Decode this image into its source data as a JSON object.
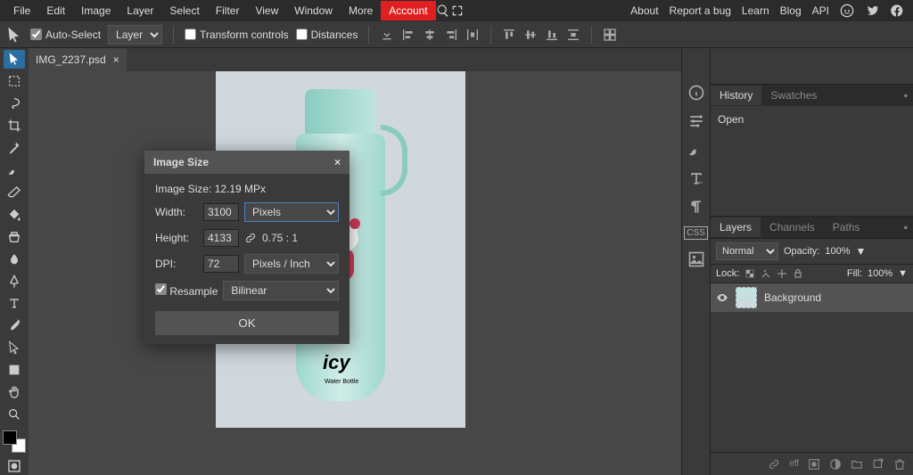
{
  "menu": {
    "file": "File",
    "edit": "Edit",
    "image": "Image",
    "layer": "Layer",
    "select": "Select",
    "filter": "Filter",
    "view": "View",
    "window": "Window",
    "more": "More",
    "account": "Account"
  },
  "rightmenu": {
    "about": "About",
    "bug": "Report a bug",
    "learn": "Learn",
    "blog": "Blog",
    "api": "API"
  },
  "optbar": {
    "autoselect": "Auto-Select",
    "layer_select": "Layer",
    "transform": "Transform controls",
    "distances": "Distances"
  },
  "doc": {
    "name": "IMG_2237.psd"
  },
  "dialog": {
    "title": "Image Size",
    "size_line": "Image Size: 12.19 MPx",
    "width_lbl": "Width:",
    "width_val": "3100",
    "height_lbl": "Height:",
    "height_val": "4133",
    "dpi_lbl": "DPI:",
    "dpi_val": "72",
    "unit": "Pixels",
    "dpi_unit": "Pixels / Inch",
    "ratio": "0.75 : 1",
    "resample_lbl": "Resample",
    "resample_method": "Bilinear",
    "ok": "OK"
  },
  "panels": {
    "history_tab": "History",
    "swatches_tab": "Swatches",
    "hist_open": "Open",
    "layers_tab": "Layers",
    "channels_tab": "Channels",
    "paths_tab": "Paths",
    "blend": "Normal",
    "opacity_lbl": "Opacity:",
    "opacity_val": "100%",
    "lock_lbl": "Lock:",
    "fill_lbl": "Fill:",
    "fill_val": "100%",
    "layer_name": "Background"
  },
  "brand": {
    "main": "icy",
    "sub": "Water Bottle"
  }
}
